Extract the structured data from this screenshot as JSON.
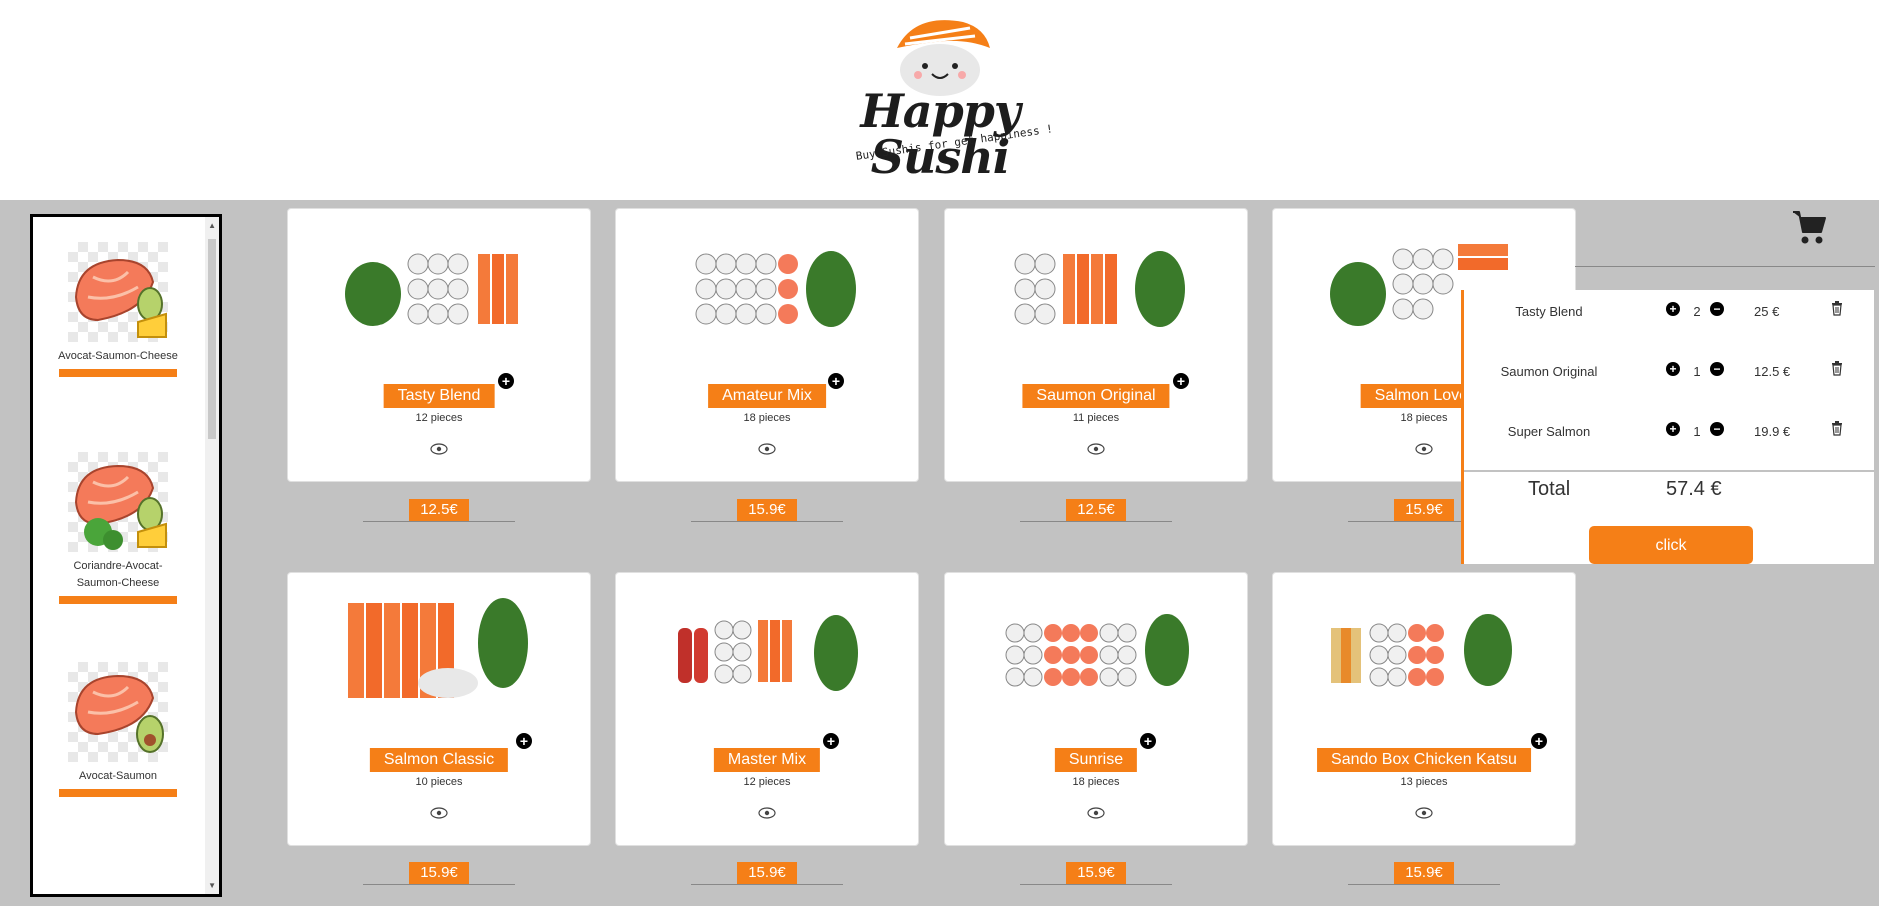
{
  "header": {
    "logo_title": "Happy Sushi",
    "logo_subtitle": "Buy Sushis for get happiness !"
  },
  "sidebar": {
    "items": [
      {
        "label": "Avocat-Saumon-Cheese",
        "icon": "salmon-avocado-cheese-icon"
      },
      {
        "label": "Coriandre-Avocat-Saumon-Cheese",
        "icon": "salmon-coriander-avocado-cheese-icon"
      },
      {
        "label": "Avocat-Saumon",
        "icon": "salmon-avocado-icon"
      }
    ]
  },
  "products": [
    {
      "name": "Tasty Blend",
      "pieces": "12 pieces",
      "price": "12.5€"
    },
    {
      "name": "Amateur Mix",
      "pieces": "18 pieces",
      "price": "15.9€"
    },
    {
      "name": "Saumon Original",
      "pieces": "11 pieces",
      "price": "12.5€"
    },
    {
      "name": "Salmon Lover",
      "pieces": "18 pieces",
      "price": "15.9€"
    },
    {
      "name": "Salmon Classic",
      "pieces": "10 pieces",
      "price": "15.9€"
    },
    {
      "name": "Master Mix",
      "pieces": "12 pieces",
      "price": "15.9€"
    },
    {
      "name": "Sunrise",
      "pieces": "18 pieces",
      "price": "15.9€"
    },
    {
      "name": "Sando Box Chicken Katsu",
      "pieces": "13 pieces",
      "price": "15.9€"
    }
  ],
  "cart": {
    "items": [
      {
        "name": "Tasty Blend",
        "qty": "2",
        "price": "25 €"
      },
      {
        "name": "Saumon Original",
        "qty": "1",
        "price": "12.5 €"
      },
      {
        "name": "Super Salmon",
        "qty": "1",
        "price": "19.9 €"
      }
    ],
    "total_label": "Total",
    "total_value": "57.4 €",
    "button_label": "click"
  },
  "colors": {
    "accent": "#f57f17",
    "background": "#c2c2c2"
  }
}
